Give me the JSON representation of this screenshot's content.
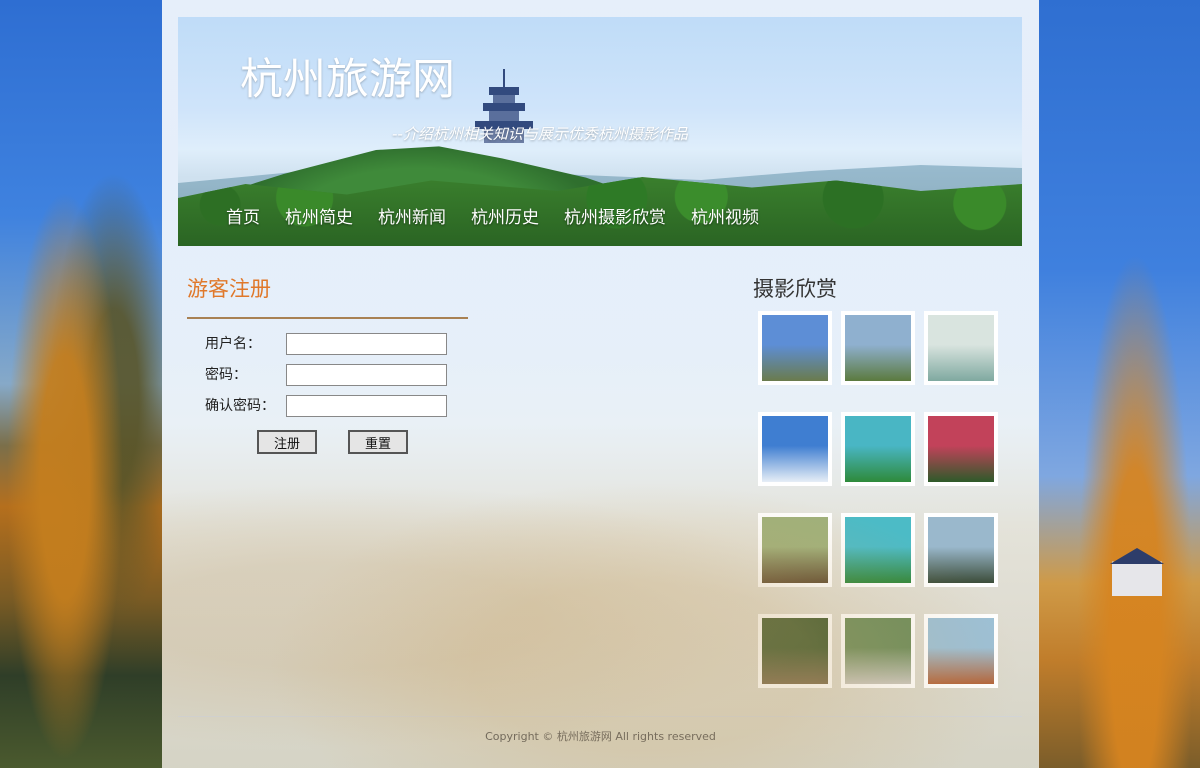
{
  "header": {
    "site_title": "杭州旅游网",
    "subtitle": "--介绍杭州相关知识与展示优秀杭州摄影作品"
  },
  "nav": {
    "items": [
      "首页",
      "杭州简史",
      "杭州新闻",
      "杭州历史",
      "杭州摄影欣赏",
      "杭州视频"
    ]
  },
  "register": {
    "title": "游客注册",
    "username_label": "用户名：",
    "password_label": "密码：",
    "confirm_label": "确认密码：",
    "username_value": "",
    "password_value": "",
    "confirm_value": "",
    "submit_label": "注册",
    "reset_label": "重置"
  },
  "gallery": {
    "title": "摄影欣赏",
    "photos": [
      {
        "name": "rocky-hill-photo",
        "colors": [
          "#5d8ed6",
          "#6a7b4c"
        ]
      },
      {
        "name": "city-bay-photo",
        "colors": [
          "#8fb0cf",
          "#5b7a3e"
        ]
      },
      {
        "name": "island-pavilion-photo",
        "colors": [
          "#d9e4df",
          "#7fa9a0"
        ]
      },
      {
        "name": "sea-wave-photo",
        "colors": [
          "#3f7ed1",
          "#e6eef6"
        ]
      },
      {
        "name": "green-islands-photo",
        "colors": [
          "#49b6c4",
          "#2e8a3a"
        ]
      },
      {
        "name": "red-gate-photo",
        "colors": [
          "#c2425a",
          "#2e5a2a"
        ]
      },
      {
        "name": "village-house-photo",
        "colors": [
          "#9fb07a",
          "#5e4a2f"
        ]
      },
      {
        "name": "green-islands-2-photo",
        "colors": [
          "#4cbbc6",
          "#2c8638"
        ]
      },
      {
        "name": "lake-pavilion-photo",
        "colors": [
          "#9ab8cc",
          "#3c4d3a"
        ]
      },
      {
        "name": "temple-gate-photo",
        "colors": [
          "#3f5a2e",
          "#7c6b4c"
        ]
      },
      {
        "name": "mountain-stele-photo",
        "colors": [
          "#6b8c5a",
          "#c8c6bf"
        ]
      },
      {
        "name": "canyon-house-photo",
        "colors": [
          "#9cc0d6",
          "#b3643a"
        ]
      }
    ]
  },
  "footer": {
    "text": "Copyright © 杭州旅游网 All rights reserved"
  }
}
